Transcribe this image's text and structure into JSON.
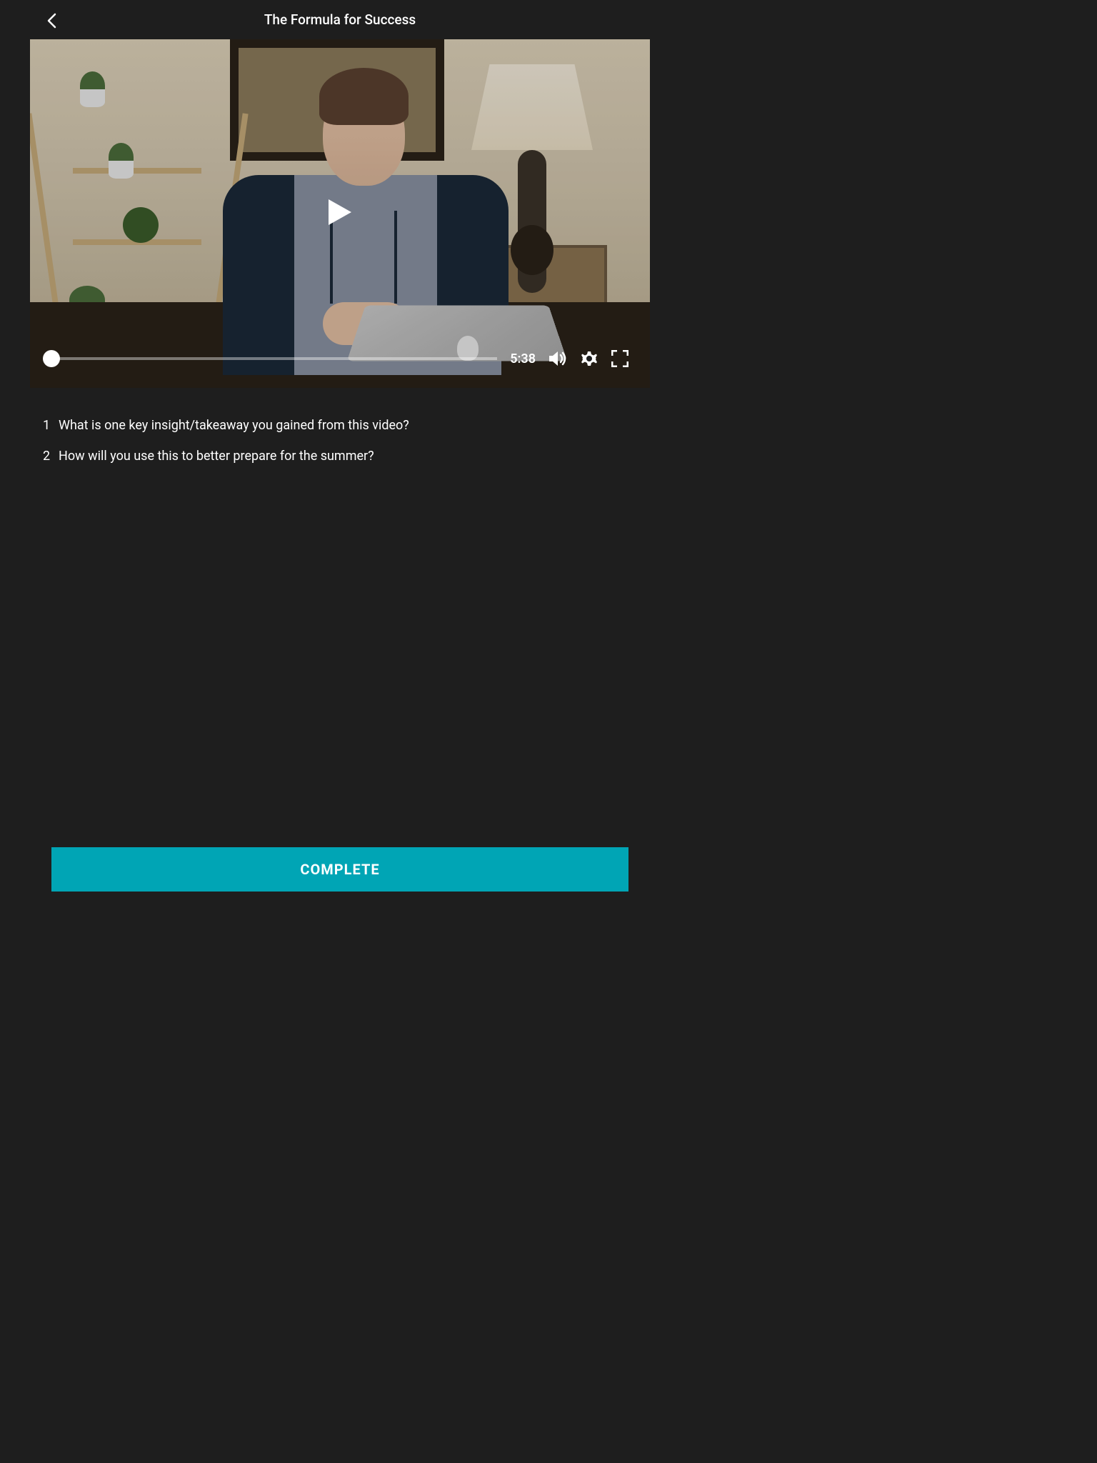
{
  "header": {
    "title": "The Formula for Success"
  },
  "video": {
    "duration": "5:38"
  },
  "questions": [
    {
      "num": "1",
      "text": "What is one key insight/takeaway you gained from this video?"
    },
    {
      "num": "2",
      "text": "How will you use this to better prepare for the summer?"
    }
  ],
  "footer": {
    "complete_label": "COMPLETE"
  },
  "colors": {
    "accent": "#00a5b5",
    "background": "#1e1e1e"
  }
}
